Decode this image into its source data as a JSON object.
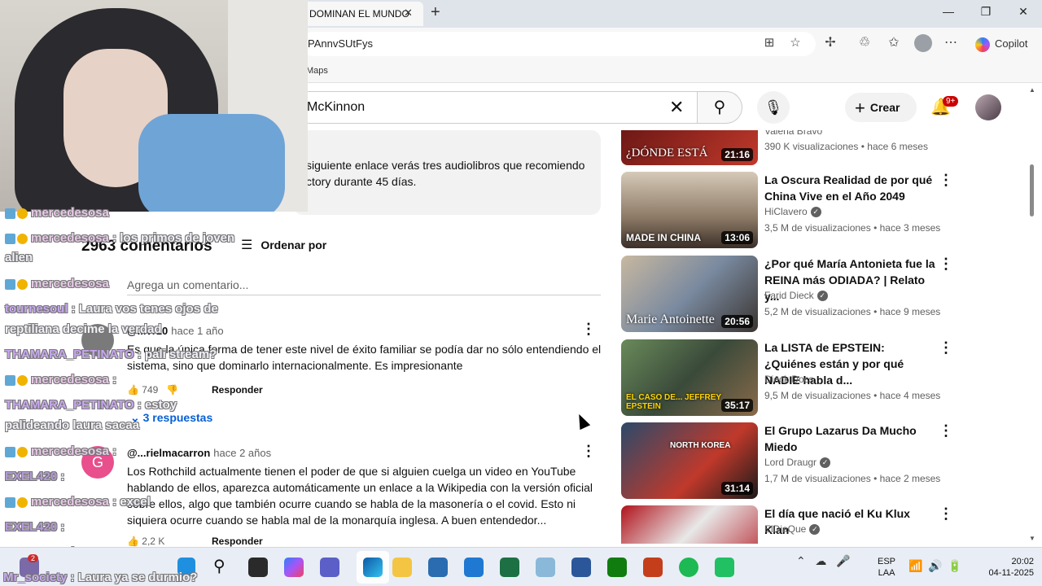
{
  "browser": {
    "tab_title": "DOMINAN EL MUNDO",
    "address": "PAnnvSUtFys",
    "favorites": [
      "Maps"
    ],
    "copilot_label": "Copilot"
  },
  "youtube": {
    "search_value": "McKinnon",
    "create_label": "Crear",
    "notification_count": "9+",
    "description": "siguiente enlace verás tres audiolibros que recomiendo ctory durante 45 días.",
    "description_line1": "siguiente enlace verás tres audiolibros que recomiendo",
    "description_line2": "ctory durante 45 días.",
    "comment_count": "2963 comentarios",
    "sort_label": "Ordenar por",
    "add_comment_placeholder": "Agrega un comentario...",
    "comments": [
      {
        "author": "@...vr10",
        "time": "hace 1 año",
        "text": "Es que la única forma de tener este nivel de éxito familiar se podía dar no sólo entendiendo el sistema, sino que dominarlo internacionalmente. Es impresionante",
        "likes": "749",
        "reply_label": "Responder",
        "replies": "3 respuestas"
      },
      {
        "author": "@...rielmacarron",
        "time": "hace 2 años",
        "avatar_letter": "G",
        "text": "Los Rothchild actualmente tienen el poder de que si alguien cuelga un video en YouTube hablando de ellos, aparezca automáticamente un enlace a la Wikipedia con la versión oficial sobre ellos, algo que también ocurre cuando se habla de la masonería o el covid. Esto ni siquiera ocurre cuando se habla mal de la monarquía inglesa. A buen entendedor...",
        "likes": "2,2 K",
        "reply_label": "Responder"
      }
    ],
    "related": [
      {
        "title": "",
        "channel": "Valena Bravo",
        "meta": "390 K visualizaciones • hace 6 meses",
        "duration": "21:16",
        "thumb_text": "¿DÓNDE ESTÁ",
        "verified": false
      },
      {
        "title": "La Oscura Realidad de por qué China Vive en el Año 2049",
        "channel": "HiClavero",
        "meta": "3,5 M de visualizaciones • hace 3 meses",
        "duration": "13:06",
        "thumb_text": "MADE IN CHINA",
        "verified": true
      },
      {
        "title": "¿Por qué María Antonieta fue la REINA más ODIADA? | Relato y...",
        "channel": "Farid Dieck",
        "meta": "5,2 M de visualizaciones • hace 9 meses",
        "duration": "20:56",
        "thumb_text": "Marie Antoinette",
        "verified": true
      },
      {
        "title": "La LISTA de EPSTEIN: ¿Quiénes están y por qué NADIE habla d...",
        "channel": "Dieck Docs",
        "meta": "9,5 M de visualizaciones • hace 4 meses",
        "duration": "35:17",
        "thumb_text": "EL CASO DE... JEFFREY EPSTEIN",
        "verified": false
      },
      {
        "title": "El Grupo Lazarus Da Mucho Miedo",
        "channel": "Lord Draugr",
        "meta": "1,7 M de visualizaciones • hace 2 meses",
        "duration": "31:14",
        "thumb_text": "NORTH KOREA",
        "verified": true
      },
      {
        "title": "El día que nació el Ku Klux Klan",
        "channel": "ElDiaQue",
        "meta": "",
        "duration": "",
        "thumb_text": "",
        "verified": true
      }
    ]
  },
  "chat": [
    {
      "user": "mercedesosa",
      "message": ": los primos de joven",
      "cont": "alien"
    },
    {
      "user": "mercedesosa",
      "message": ""
    },
    {
      "user": "tournesoul",
      "message": ": Laura vos tenes ojos de",
      "cont": "reptiliana decime la verdad"
    },
    {
      "user": "THAMARA_PETINATO",
      "message": ": pali stream?"
    },
    {
      "user": "mercedesosa",
      "message": ":"
    },
    {
      "user": "THAMARA_PETINATO",
      "message": ": estoy",
      "cont": "palideando laura sacaa"
    },
    {
      "user": "mercedesosa",
      "message": ":"
    },
    {
      "user": "EXEL420",
      "message": ":"
    },
    {
      "user": "mercedesosa",
      "message": ": excel"
    },
    {
      "user": "EXEL420",
      "message": ":"
    },
    {
      "user": "mercedesosa",
      "message": ":"
    },
    {
      "user": "Mr_society",
      "message": ": Laura ya se durmio?"
    }
  ],
  "taskbar": {
    "language": "ESP",
    "layout": "LAA",
    "time": "20:02",
    "date": "04-11-2025",
    "badge_count": "2"
  },
  "colors": {
    "youtube_red": "#cc0000",
    "link_blue": "#065fd4",
    "taskbar_bg": "#e9eef6"
  }
}
